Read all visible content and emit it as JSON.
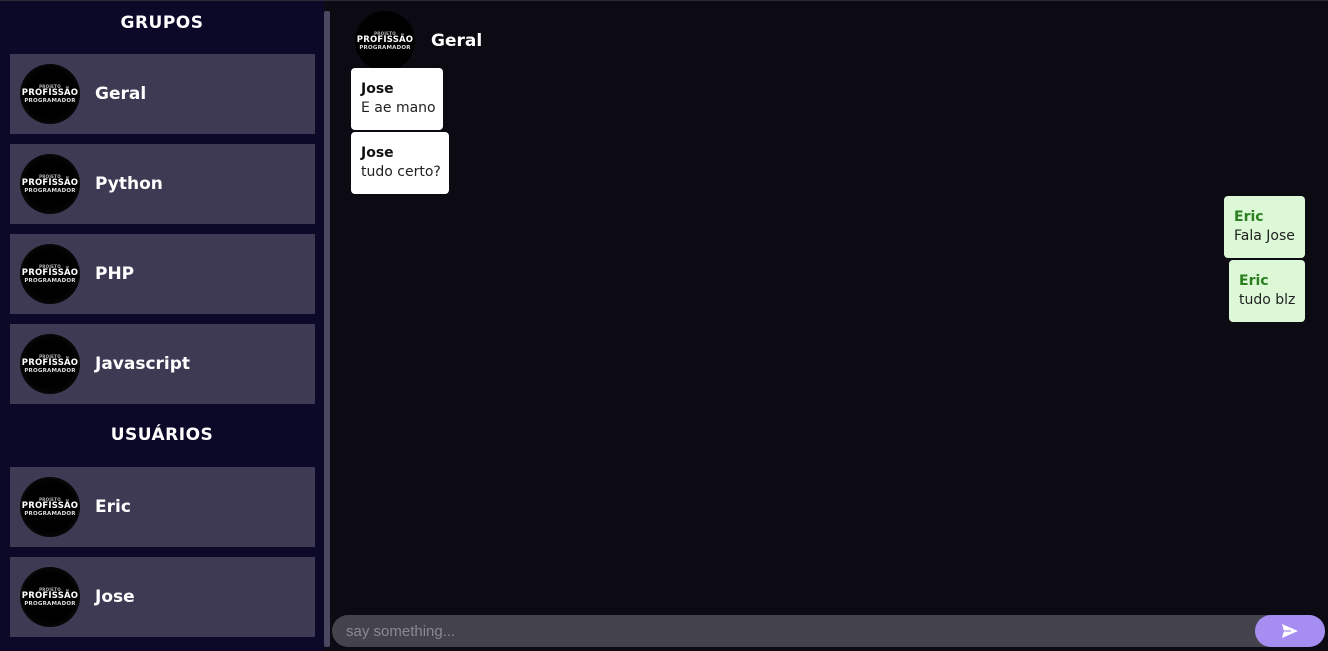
{
  "sidebar": {
    "groups_title": "GRUPOS",
    "groups": [
      {
        "label": "Geral"
      },
      {
        "label": "Python"
      },
      {
        "label": "PHP"
      },
      {
        "label": "Javascript"
      }
    ],
    "users_title": "USUÁRIOS",
    "users": [
      {
        "label": "Eric"
      },
      {
        "label": "Jose"
      }
    ]
  },
  "avatar": {
    "line1": "PROJETO",
    "line2": "PROFISSÃO",
    "line3": "PROGRAMADOR"
  },
  "chat": {
    "title": "Geral",
    "messages": [
      {
        "author": "Jose",
        "text": "E ae mano",
        "direction": "incoming"
      },
      {
        "author": "Jose",
        "text": "tudo certo?",
        "direction": "incoming"
      },
      {
        "author": "Eric",
        "text": "Fala Jose",
        "direction": "outgoing"
      },
      {
        "author": "Eric",
        "text": "tudo blz",
        "direction": "outgoing"
      }
    ]
  },
  "composer": {
    "placeholder": "say something...",
    "send_icon": "send-icon"
  },
  "colors": {
    "sidebar_bg": "#0c0828",
    "item_bg": "#3f3a54",
    "chat_bg": "#0c0b13",
    "incoming_bubble": "#ffffff",
    "outgoing_bubble": "#dcf8d6",
    "send_button": "#a58df2"
  }
}
